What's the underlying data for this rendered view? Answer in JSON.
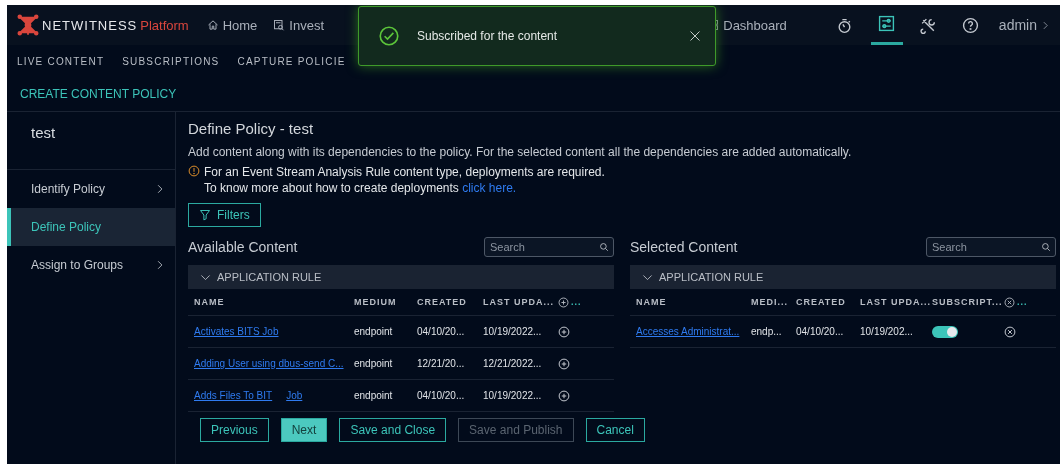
{
  "header": {
    "logo": {
      "brand": "NETWITNESS",
      "product": "Platform"
    },
    "nav": [
      {
        "label": "Home"
      },
      {
        "label": "Invest"
      },
      {
        "label": "Dashboard"
      }
    ],
    "tools": [
      {
        "selected": false
      },
      {
        "selected": true
      },
      {
        "selected": false
      },
      {
        "selected": false
      }
    ],
    "user": "admin"
  },
  "toast": {
    "message": "Subscribed for the content"
  },
  "subnav": [
    {
      "label": "LIVE CONTENT"
    },
    {
      "label": "SUBSCRIPTIONS"
    },
    {
      "label": "CAPTURE POLICIE"
    }
  ],
  "page_title": "CREATE CONTENT POLICY",
  "sidebar": {
    "title": "test",
    "items": [
      {
        "label": "Identify Policy",
        "selected": false
      },
      {
        "label": "Define Policy",
        "selected": true
      },
      {
        "label": "Assign to Groups",
        "selected": false
      }
    ]
  },
  "main": {
    "title": "Define Policy - test",
    "description": "Add content along with its dependencies to the policy. For the selected content all the dependencies are added automatically.",
    "warning": {
      "line1": "For an Event Stream Analysis Rule content type, deployments are required.",
      "line2": "To know more about how to create deployments",
      "link": "click here."
    },
    "filters_button": "Filters",
    "available": {
      "title": "Available Content",
      "search_placeholder": "Search",
      "group": "APPLICATION RULE",
      "columns": [
        "NAME",
        "MEDIUM",
        "CREATED",
        "LAST UPDA...",
        "..."
      ],
      "rows": [
        {
          "name": "Activates BITS Job",
          "medium": "endpoint",
          "created": "04/10/20...",
          "last_updated": "10/19/2022..."
        },
        {
          "name": "Adding User using dbus-send C...",
          "medium": "endpoint",
          "created": "12/21/20...",
          "last_updated": "12/21/2022..."
        },
        {
          "name": "Adds Files To BIT",
          "name_end": "Job",
          "medium": "endpoint",
          "created": "04/10/20...",
          "last_updated": "10/19/2022..."
        }
      ]
    },
    "selected": {
      "title": "Selected Content",
      "search_placeholder": "Search",
      "group": "APPLICATION RULE",
      "columns": [
        "NAME",
        "MEDI...",
        "CREATED",
        "LAST UPDA...",
        "SUBSCRIPT...",
        "..."
      ],
      "rows": [
        {
          "name": "Accesses Administrat...",
          "medium": "endp...",
          "created": "04/10/20...",
          "last_updated": "10/19/202...",
          "subscribed": true
        }
      ]
    }
  },
  "footer": [
    {
      "label": "Previous",
      "kind": "secondary",
      "disabled": false
    },
    {
      "label": "Next",
      "kind": "primary",
      "disabled": false
    },
    {
      "label": "Save and Close",
      "kind": "secondary",
      "disabled": false
    },
    {
      "label": "Save and Publish",
      "kind": "secondary",
      "disabled": true
    },
    {
      "label": "Cancel",
      "kind": "secondary",
      "disabled": false
    }
  ]
}
